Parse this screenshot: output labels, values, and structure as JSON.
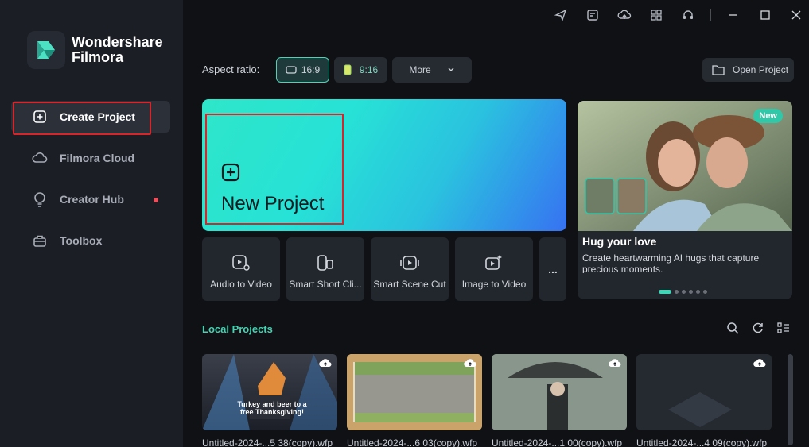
{
  "app": {
    "brand_line1": "Wondershare",
    "brand_line2": "Filmora"
  },
  "sidebar": {
    "items": [
      {
        "label": "Create Project",
        "icon": "plus-square-icon"
      },
      {
        "label": "Filmora Cloud",
        "icon": "cloud-icon"
      },
      {
        "label": "Creator Hub",
        "icon": "bulb-icon"
      },
      {
        "label": "Toolbox",
        "icon": "toolbox-icon"
      }
    ]
  },
  "titlebar": {
    "icons": [
      "send-icon",
      "task-icon",
      "cloud-upload-icon",
      "apps-grid-icon",
      "headset-icon",
      "minimize-icon",
      "maximize-icon",
      "close-icon"
    ]
  },
  "aspect": {
    "label": "Aspect ratio:",
    "options": [
      {
        "label": "16:9",
        "selected": true
      },
      {
        "label": "9:16",
        "selected": false
      }
    ],
    "more_label": "More",
    "open_project_label": "Open Project"
  },
  "new_project": {
    "label": "New Project"
  },
  "tools": [
    {
      "label": "Audio to Video",
      "icon": "audio-to-video-icon"
    },
    {
      "label": "Smart Short Cli...",
      "icon": "smart-short-clips-icon"
    },
    {
      "label": "Smart Scene Cut",
      "icon": "scene-cut-icon"
    },
    {
      "label": "Image to Video",
      "icon": "image-to-video-icon"
    }
  ],
  "more_tools_label": "...",
  "promo": {
    "badge": "New",
    "title": "Hug your love",
    "desc": "Create heartwarming AI hugs that capture precious moments.",
    "slides": 6,
    "active_slide": 0
  },
  "local_projects": {
    "title": "Local Projects",
    "items": [
      {
        "name": "Untitled-2024-...5 38(copy).wfp",
        "thumb_text": "Turkey and beer to a free Thanksgiving!"
      },
      {
        "name": "Untitled-2024-...6 03(copy).wfp"
      },
      {
        "name": "Untitled-2024-...1 00(copy).wfp"
      },
      {
        "name": "Untitled-2024-...4 09(copy).wfp"
      }
    ]
  },
  "colors": {
    "accent": "#45d3b2",
    "highlight_box": "#d9252a",
    "background": "#0f1115",
    "sidebar": "#1b1e25"
  }
}
